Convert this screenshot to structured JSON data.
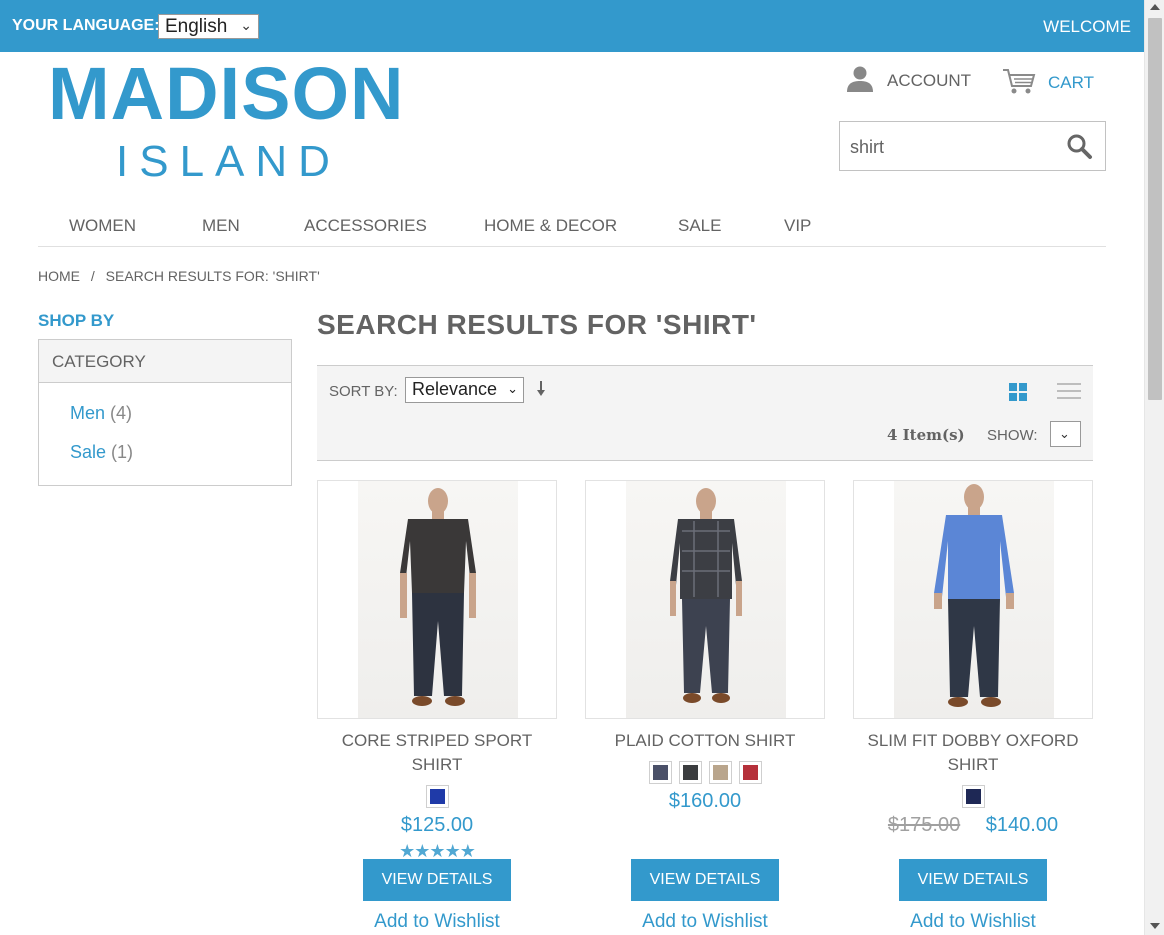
{
  "header": {
    "language_label": "YOUR LANGUAGE:",
    "language_value": "English",
    "welcome": "WELCOME",
    "logo_top": "MADISON",
    "logo_bottom": "ISLAND",
    "account_label": "ACCOUNT",
    "cart_label": "CART",
    "search_value": "shirt"
  },
  "nav": {
    "items": [
      {
        "label": "WOMEN"
      },
      {
        "label": "MEN"
      },
      {
        "label": "ACCESSORIES"
      },
      {
        "label": "HOME & DECOR"
      },
      {
        "label": "SALE"
      },
      {
        "label": "VIP"
      }
    ]
  },
  "breadcrumb": {
    "home": "HOME",
    "separator": "/",
    "current": "SEARCH RESULTS FOR: 'SHIRT'"
  },
  "sidebar": {
    "shop_by": "SHOP BY",
    "category_title": "CATEGORY",
    "categories": [
      {
        "name": "Men",
        "count": "(4)"
      },
      {
        "name": "Sale",
        "count": "(1)"
      }
    ]
  },
  "main": {
    "title": "SEARCH RESULTS FOR 'SHIRT'",
    "toolbar": {
      "sort_label": "SORT BY:",
      "sort_value": "Relevance",
      "item_count": "4 Item(s)",
      "show_label": "SHOW:"
    }
  },
  "products": [
    {
      "name": "CORE STRIPED SPORT SHIRT",
      "swatches": [
        "#1f3aa8"
      ],
      "price": "$125.00",
      "rating": 5,
      "stars": "★★★★★",
      "button": "VIEW DETAILS",
      "wishlist": "Add to Wishlist",
      "shirt_color": "#3a3838"
    },
    {
      "name": "PLAID COTTON SHIRT",
      "swatches": [
        "#4a5068",
        "#3b3d3f",
        "#b9a58c",
        "#b5303a"
      ],
      "price": "$160.00",
      "button": "VIEW DETAILS",
      "wishlist": "Add to Wishlist",
      "shirt_color": "#3c3e44"
    },
    {
      "name": "SLIM FIT DOBBY OXFORD SHIRT",
      "swatches": [
        "#1e2855"
      ],
      "old_price": "$175.00",
      "price": "$140.00",
      "button": "VIEW DETAILS",
      "wishlist": "Add to Wishlist",
      "shirt_color": "#5b86d6"
    }
  ],
  "colors": {
    "accent": "#3399cc",
    "text": "#636363"
  }
}
